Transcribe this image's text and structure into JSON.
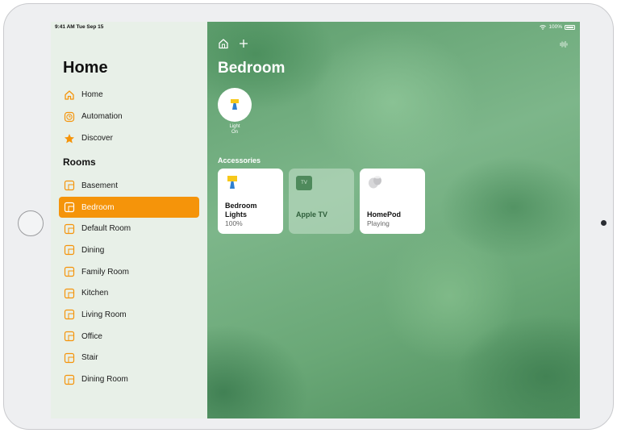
{
  "status": {
    "time": "9:41 AM  Tue Sep 15",
    "battery": "100%"
  },
  "sidebar": {
    "title": "Home",
    "nav": [
      {
        "label": "Home",
        "icon": "house-icon"
      },
      {
        "label": "Automation",
        "icon": "clock-icon"
      },
      {
        "label": "Discover",
        "icon": "star-icon"
      }
    ],
    "rooms_title": "Rooms",
    "rooms": [
      {
        "label": "Basement",
        "selected": false
      },
      {
        "label": "Bedroom",
        "selected": true
      },
      {
        "label": "Default Room",
        "selected": false
      },
      {
        "label": "Dining",
        "selected": false
      },
      {
        "label": "Family Room",
        "selected": false
      },
      {
        "label": "Kitchen",
        "selected": false
      },
      {
        "label": "Living Room",
        "selected": false
      },
      {
        "label": "Office",
        "selected": false
      },
      {
        "label": "Stair",
        "selected": false
      },
      {
        "label": "Dining Room",
        "selected": false
      }
    ]
  },
  "main": {
    "title": "Bedroom",
    "scene": {
      "line1": "Light",
      "line2": "On"
    },
    "accessories_title": "Accessories",
    "accessories": [
      {
        "name": "Bedroom Lights",
        "status": "100%",
        "icon": "lamp-icon"
      },
      {
        "name": "Apple TV",
        "status": "",
        "icon": "apple-tv-icon",
        "badge": "TV"
      },
      {
        "name": "HomePod",
        "status": "Playing",
        "icon": "homepod-icon"
      }
    ]
  },
  "colors": {
    "accent": "#f5940a",
    "sidebar_bg": "#e8f0e8"
  }
}
